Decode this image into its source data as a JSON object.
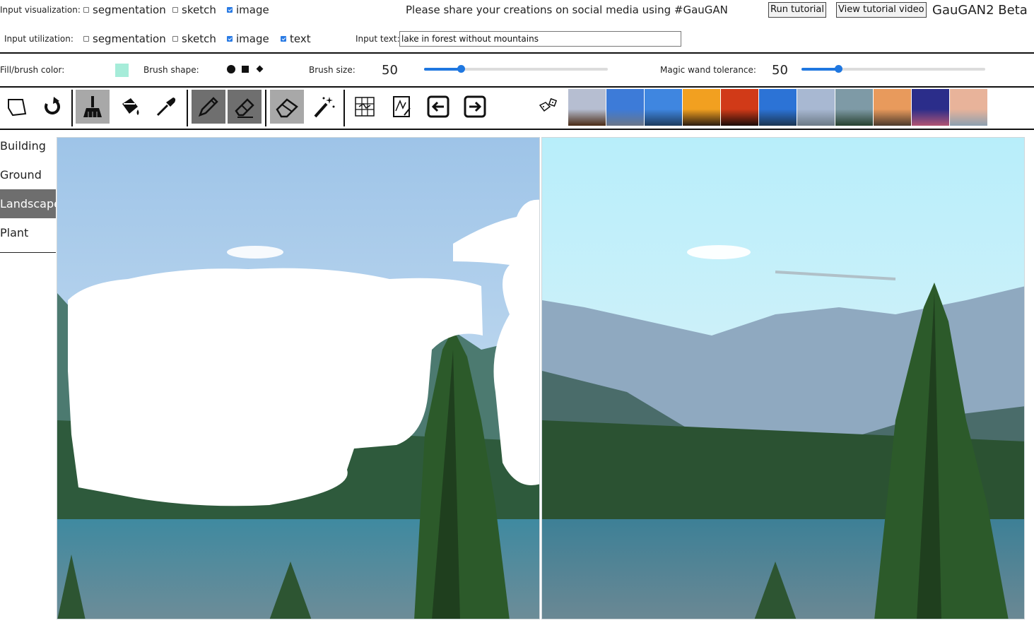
{
  "top": {
    "viz_label": "Input visualization:",
    "viz_options": [
      {
        "label": "segmentation",
        "checked": false
      },
      {
        "label": "sketch",
        "checked": false
      },
      {
        "label": "image",
        "checked": true
      }
    ],
    "util_label": "Input utilization:",
    "util_options": [
      {
        "label": "segmentation",
        "checked": false
      },
      {
        "label": "sketch",
        "checked": false
      },
      {
        "label": "image",
        "checked": true
      },
      {
        "label": "text",
        "checked": true
      }
    ],
    "share_message": "Please share your creations on social media using #GauGAN",
    "run_tutorial": "Run tutorial",
    "view_tutorial_video": "View tutorial video",
    "app_title": "GauGAN2 Beta",
    "input_text_label": "Input text:",
    "input_text_value": "lake in forest without mountains"
  },
  "brush": {
    "fill_label": "Fill/brush color:",
    "fill_color": "#a6ecd9",
    "shape_label": "Brush shape:",
    "size_label": "Brush size:",
    "size_value": "50",
    "size_fraction": 0.2,
    "tolerance_label": "Magic wand tolerance:",
    "tolerance_value": "50",
    "tolerance_fraction": 0.2
  },
  "toolbar": {
    "icons": [
      "new-layer-icon",
      "redo-icon",
      "brush-icon",
      "fill-bucket-icon",
      "eyedropper-icon",
      "pencil-icon",
      "pencil-eraser-icon",
      "eraser-icon",
      "magic-wand-icon",
      "grid-icon",
      "sketch-pad-icon",
      "arrow-left-icon",
      "arrow-right-icon",
      "dice-icon"
    ]
  },
  "thumbnails": [
    {
      "top": "#b6bed1",
      "bottom": "#4a2a14"
    },
    {
      "top": "#3d7bd8",
      "bottom": "#6b7688"
    },
    {
      "top": "#3f86e0",
      "bottom": "#1d3b5e"
    },
    {
      "top": "#f2a020",
      "bottom": "#2b1c10"
    },
    {
      "top": "#d13a18",
      "bottom": "#1a0b08"
    },
    {
      "top": "#2c73d6",
      "bottom": "#1b3552"
    },
    {
      "top": "#a8b8d2",
      "bottom": "#6c7a86"
    },
    {
      "top": "#7e9aa6",
      "bottom": "#27402e"
    },
    {
      "top": "#e89a5c",
      "bottom": "#4c3a2c"
    },
    {
      "top": "#2b2d8a",
      "bottom": "#b25472"
    },
    {
      "top": "#e8b39a",
      "bottom": "#8ca0b0"
    }
  ],
  "sidebar": {
    "items": [
      {
        "label": "Building",
        "selected": false
      },
      {
        "label": "Ground",
        "selected": false
      },
      {
        "label": "Landscape",
        "selected": true
      },
      {
        "label": "Plant",
        "selected": false
      }
    ]
  }
}
